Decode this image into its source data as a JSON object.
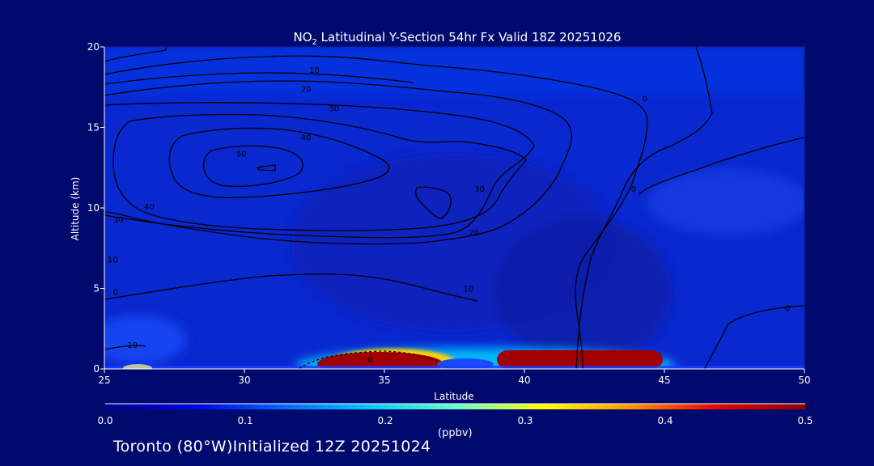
{
  "title_prefix": "NO",
  "title_subscript": "2",
  "title_suffix": " Latitudinal Y-Section 54hr  Fx Valid 18Z 20251026",
  "footer": "Toronto (80°W)Initialized 12Z 20251024",
  "colors": {
    "background": "#000a6e",
    "text": "#ffffff",
    "colormap": [
      "#00008c",
      "#0000e6",
      "#0064ff",
      "#00c8ff",
      "#64ffc8",
      "#ffff00",
      "#ff9600",
      "#e60000",
      "#8c0000"
    ]
  },
  "chart_data": {
    "type": "heatmap",
    "title": "NO2 Latitudinal Y-Section 54hr  Fx Valid 18Z 20251026",
    "xlabel": "Latitude",
    "ylabel": "Altitude (km)",
    "xlim": [
      25,
      50
    ],
    "ylim": [
      0,
      20
    ],
    "x_ticks": [
      "25",
      "30",
      "35",
      "40",
      "45",
      "50"
    ],
    "y_ticks": [
      "0",
      "5",
      "10",
      "15",
      "20"
    ],
    "colorbar": {
      "label": "(ppbv)",
      "range": [
        0.0,
        0.5
      ],
      "ticks": [
        "0.0",
        "0.1",
        "0.2",
        "0.3",
        "0.4",
        "0.5"
      ]
    },
    "field_regions": [
      {
        "name": "surface-max-north",
        "lat_range": [
          39.2,
          44.8
        ],
        "alt_range": [
          0,
          1.2
        ],
        "value": 0.48
      },
      {
        "name": "surface-max-south",
        "lat_range": [
          32.6,
          37.5
        ],
        "alt_range": [
          0,
          1.3
        ],
        "value": 0.46
      },
      {
        "name": "surface-rim",
        "lat_range": [
          32.0,
          45.2
        ],
        "alt_range": [
          0,
          1.6
        ],
        "value": 0.3
      },
      {
        "name": "background-upper",
        "lat_range": [
          25,
          50
        ],
        "alt_range": [
          2,
          20
        ],
        "value": 0.06
      },
      {
        "name": "background-lower",
        "lat_range": [
          25,
          50
        ],
        "alt_range": [
          0,
          2
        ],
        "value": 0.03
      }
    ],
    "contour_labels": [
      {
        "text": "10",
        "lat": 32.5,
        "alt": 18.6
      },
      {
        "text": "20",
        "lat": 32.2,
        "alt": 17.4
      },
      {
        "text": "30",
        "lat": 33.2,
        "alt": 16.2
      },
      {
        "text": "40",
        "lat": 32.2,
        "alt": 14.4
      },
      {
        "text": "50",
        "lat": 29.9,
        "alt": 13.4
      },
      {
        "text": "40",
        "lat": 26.6,
        "alt": 10.1
      },
      {
        "text": "30",
        "lat": 25.5,
        "alt": 9.3
      },
      {
        "text": "10",
        "lat": 25.3,
        "alt": 6.8
      },
      {
        "text": "0",
        "lat": 25.4,
        "alt": 4.8
      },
      {
        "text": "10",
        "lat": 26.0,
        "alt": 1.5
      },
      {
        "text": "30",
        "lat": 38.4,
        "alt": 11.2
      },
      {
        "text": "20",
        "lat": 38.2,
        "alt": 8.5
      },
      {
        "text": "10",
        "lat": 38.0,
        "alt": 5.0
      },
      {
        "text": "0",
        "lat": 44.3,
        "alt": 16.8
      },
      {
        "text": "0",
        "lat": 43.9,
        "alt": 11.2
      },
      {
        "text": "0",
        "lat": 49.4,
        "alt": 3.8
      },
      {
        "text": "0",
        "lat": 34.5,
        "alt": 0.6
      }
    ]
  }
}
